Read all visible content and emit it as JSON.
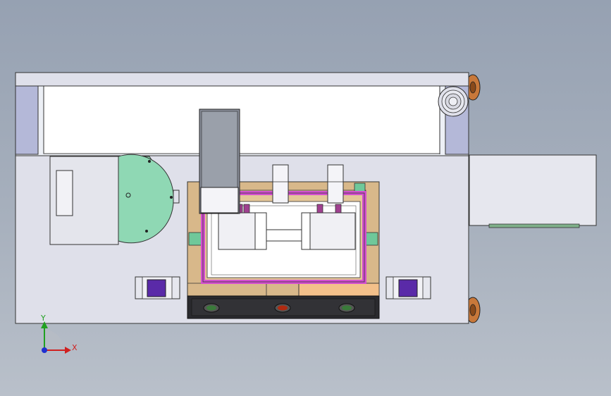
{
  "viewport": {
    "background_top": "#96a1b2",
    "background_bottom": "#b9c0ca"
  },
  "triad": {
    "y_label": "Y",
    "x_label": "X",
    "y_color": "#20a020",
    "x_color": "#d02020",
    "z_color": "#2030d0"
  },
  "colors": {
    "base_plate": "#dfe0ea",
    "rail_end": "#b4b8d8",
    "wood": "#d8b88a",
    "wood_light": "#f3c08a",
    "magenta": "#d44fd0",
    "teal_disc": "#8fd8b4",
    "green_block": "#6fc89a",
    "indicator_panel": "#2a2a2e",
    "indicator_red": "#b02a10",
    "indicator_green": "#3a7a3a",
    "caster": "#c8783a",
    "button_purple": "#5a2aa8",
    "motor_block": "#8a8f9a"
  }
}
